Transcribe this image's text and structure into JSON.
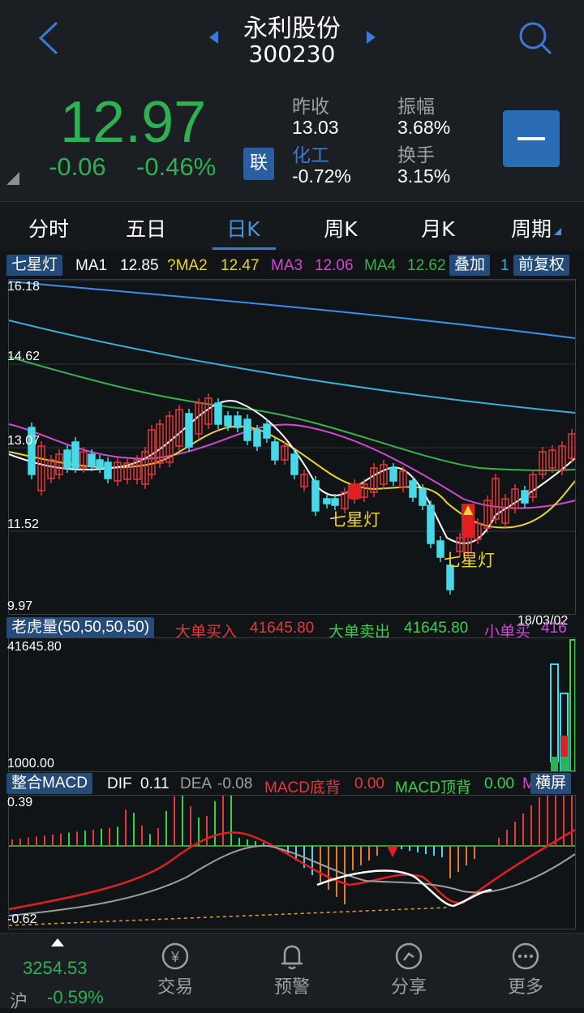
{
  "header": {
    "name": "永利股份",
    "code": "300230"
  },
  "quote": {
    "price": "12.97",
    "change": "-0.06",
    "change_pct": "-0.46%",
    "lian": "联",
    "prev_close_label": "昨收",
    "prev_close": "13.03",
    "amplitude_label": "振幅",
    "amplitude": "3.68%",
    "sector_label": "化工",
    "sector_change": "-0.72%",
    "turnover_label": "换手",
    "turnover": "3.15%",
    "up_color": "#e03a3a",
    "down_color": "#2db153"
  },
  "tabs": [
    {
      "label": "分时",
      "active": false
    },
    {
      "label": "五日",
      "active": false
    },
    {
      "label": "日K",
      "active": true
    },
    {
      "label": "周K",
      "active": false
    },
    {
      "label": "月K",
      "active": false
    },
    {
      "label": "周期",
      "active": false
    }
  ],
  "ma_row": {
    "indicator": "七星灯",
    "ma1_label": "MA1",
    "ma1": "12.85",
    "ma2_label": "?MA2",
    "ma2": "12.47",
    "ma3_label": "MA3",
    "ma3": "12.06",
    "ma4_label": "MA4",
    "ma4": "12.62",
    "overlay": "叠加",
    "trailing": "1",
    "adjust": "前复权"
  },
  "kline": {
    "y_labels": [
      "16.18",
      "14.62",
      "13.07",
      "11.52",
      "9.97"
    ],
    "ymin": 9.97,
    "ymax": 16.18,
    "annotation1": "七星灯",
    "annotation2": "七星灯",
    "date": "18/03/02"
  },
  "volume": {
    "title": "老虎量(50,50,50,50)",
    "buy_label": "大单买入",
    "buy_value": "41645.80",
    "sell_label": "大单卖出",
    "sell_value": "41645.80",
    "small_label": "小单买",
    "small_value": "416",
    "y_top": "41645.80",
    "y_bottom": "1000.00"
  },
  "macd": {
    "title": "整合MACD",
    "dif_label": "DIF",
    "dif": "0.11",
    "dea_label": "DEA",
    "dea": "-0.08",
    "bottom_label": "MACD底背",
    "bottom_value": "0.00",
    "top_label": "MACD顶背",
    "top_value": "0.00",
    "trailing": "M",
    "landscape": "横屏",
    "y_top": "0.39",
    "y_bottom": "-0.62"
  },
  "footer": {
    "index_value": "3254.53",
    "index_name": "沪",
    "index_change": "-0.59%",
    "items": [
      "交易",
      "预警",
      "分享",
      "更多"
    ]
  }
}
